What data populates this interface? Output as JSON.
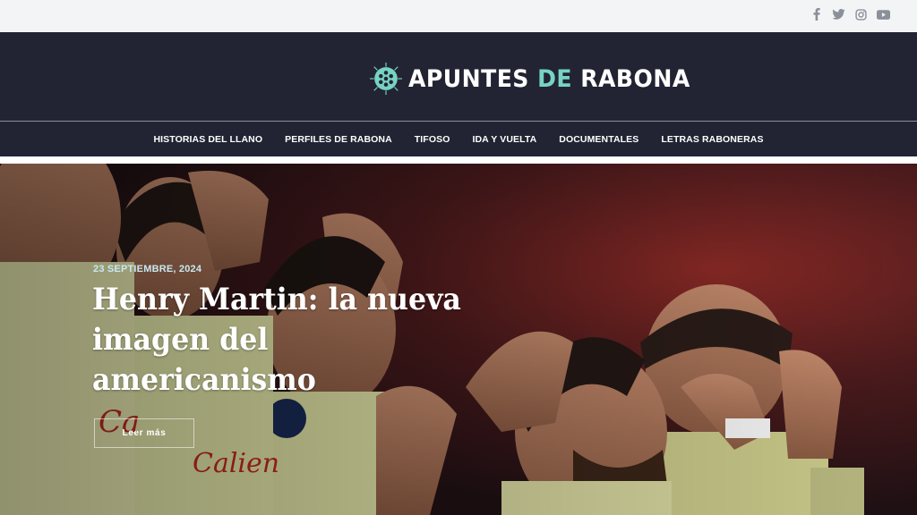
{
  "topbar": {
    "social": [
      {
        "icon": "facebook-icon"
      },
      {
        "icon": "twitter-icon"
      },
      {
        "icon": "instagram-icon"
      },
      {
        "icon": "youtube-icon"
      }
    ],
    "icon_color": "#8a9099"
  },
  "header": {
    "logo_primary": "APUNTES",
    "logo_connector": "DE",
    "logo_secondary": "RABONA",
    "background": "#222433",
    "accent": "#77d3c4"
  },
  "nav": {
    "items": [
      {
        "label": "HISTORIAS DEL LLANO"
      },
      {
        "label": "PERFILES DE RABONA"
      },
      {
        "label": "TIFOSO"
      },
      {
        "label": "IDA Y VUELTA"
      },
      {
        "label": "DOCUMENTALES"
      },
      {
        "label": "LETRAS RABONERAS"
      }
    ]
  },
  "hero": {
    "date": "23 SEPTIEMBRE, 2024",
    "title": "Henry Martin: la nueva imagen del americanismo",
    "button_label": "Leer más",
    "image": "players-celebrating-photo"
  }
}
